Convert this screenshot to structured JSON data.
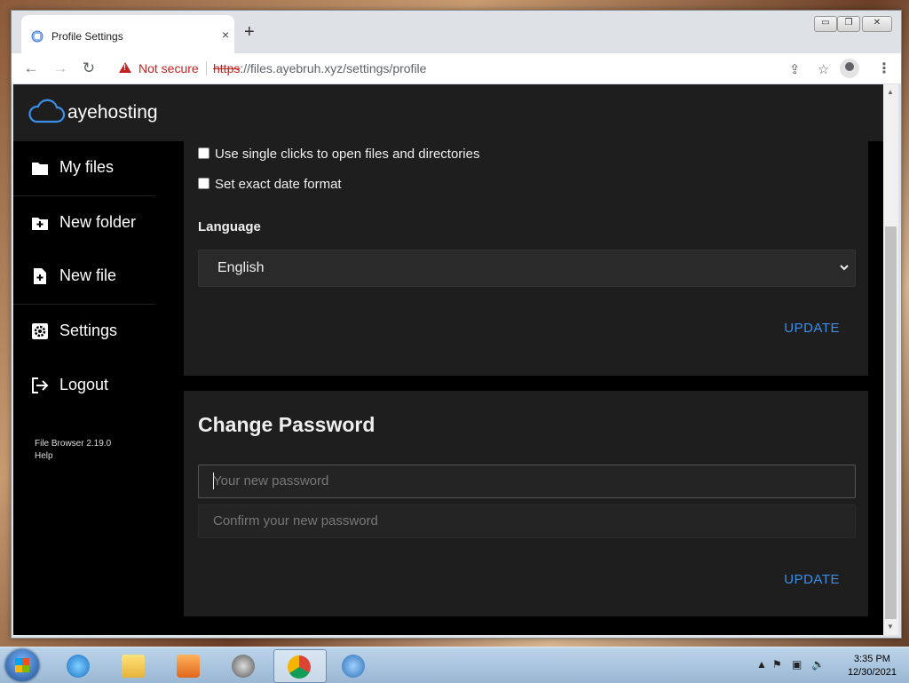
{
  "browser": {
    "tab_title": "Profile Settings",
    "tab_close": "×",
    "new_tab": "+",
    "win_minimize": "▭",
    "win_restore": "❐",
    "win_close": "✕",
    "security_label": "Not secure",
    "url_scheme": "https",
    "url_rest": "://files.ayebruh.xyz/settings/profile",
    "back": "←",
    "forward": "→",
    "reload": "↻",
    "share_icon": "⇪",
    "bookmark_icon": "☆",
    "menu": "⋮"
  },
  "app": {
    "brand": "ayehosting",
    "sidebar": {
      "items": [
        {
          "label": "My files",
          "icon": "folder-icon"
        },
        {
          "label": "New folder",
          "icon": "new-folder-icon"
        },
        {
          "label": "New file",
          "icon": "new-file-icon"
        },
        {
          "label": "Settings",
          "icon": "gear-icon"
        },
        {
          "label": "Logout",
          "icon": "logout-icon"
        }
      ],
      "version": "File Browser 2.19.0",
      "help": "Help"
    },
    "profile": {
      "option_single_click": "Use single clicks to open files and directories",
      "option_date_format": "Set exact date format",
      "single_click_checked": false,
      "date_format_checked": false,
      "language_label": "Language",
      "language_value": "English",
      "update_label": "UPDATE"
    },
    "password": {
      "title": "Change Password",
      "new_placeholder": "Your new password",
      "confirm_placeholder": "Confirm your new password",
      "update_label": "UPDATE"
    },
    "accent_color": "#3a8fe8"
  },
  "taskbar": {
    "time": "3:35 PM",
    "date": "12/30/2021"
  }
}
